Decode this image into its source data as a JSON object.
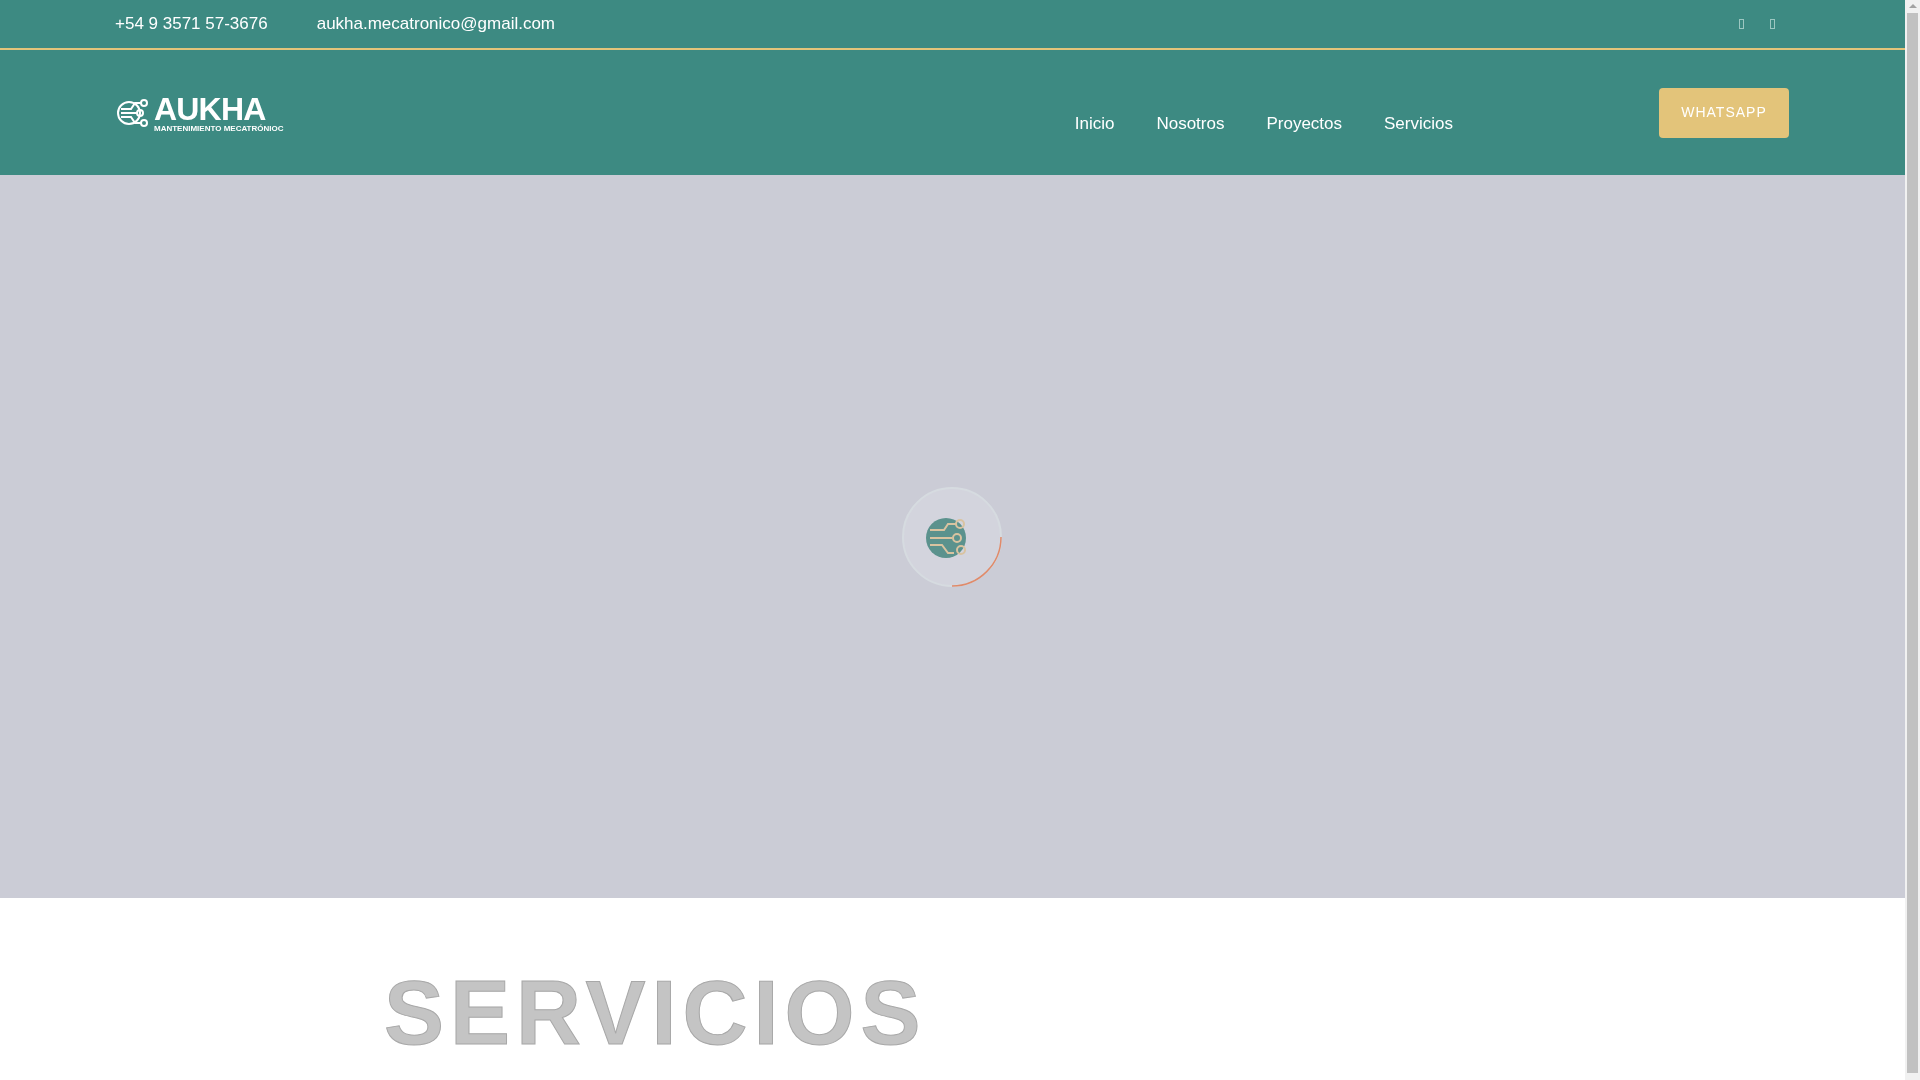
{
  "top_bar": {
    "phone": "+54 9 3571 57-3676",
    "email": "aukha.mecatronico@gmail.com",
    "social_links": [
      {
        "kind": "icon"
      },
      {
        "kind": "icon"
      }
    ]
  },
  "logo": {
    "name": "AUKHA",
    "tagline": "MANTENIMIENTO MECATRÓNIOC"
  },
  "nav": {
    "items": [
      {
        "label": "Inicio"
      },
      {
        "label": "Nosotros"
      },
      {
        "label": "Proyectos"
      },
      {
        "label": "Servicios"
      }
    ],
    "button": "WHATSAPP"
  },
  "hero": {
    "kind": "loading"
  },
  "section_heading": "SERVICIOS"
}
